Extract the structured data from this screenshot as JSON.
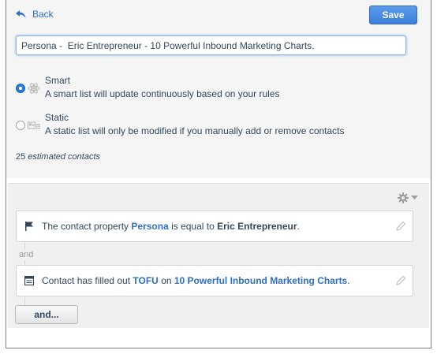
{
  "header": {
    "back_label": "Back",
    "save_label": "Save"
  },
  "list_name": {
    "value": "Persona -  Eric Entrepreneur - 10 Powerful Inbound Marketing Charts."
  },
  "list_types": [
    {
      "title": "Smart",
      "description": "A smart list will update continuously based on your rules",
      "selected": true
    },
    {
      "title": "Static",
      "description": "A static list will only be modified if you manually add or remove contacts",
      "selected": false
    }
  ],
  "estimate": {
    "count": "25",
    "label": "estimated contacts"
  },
  "filters": {
    "rules": [
      {
        "icon": "flag-icon",
        "prefix": "The contact property ",
        "property": "Persona",
        "middle": " is equal to ",
        "value": "Eric Entrepreneur",
        "suffix": "."
      },
      {
        "icon": "form-icon",
        "prefix": "Contact has filled out ",
        "property": "TOFU",
        "middle": " on ",
        "value": "10 Powerful Inbound Marketing Charts",
        "suffix": "."
      }
    ],
    "connector": "and",
    "add_label": "and..."
  },
  "colors": {
    "accent": "#3b7fd9",
    "link": "#2e6fc4",
    "text": "#33475b"
  }
}
